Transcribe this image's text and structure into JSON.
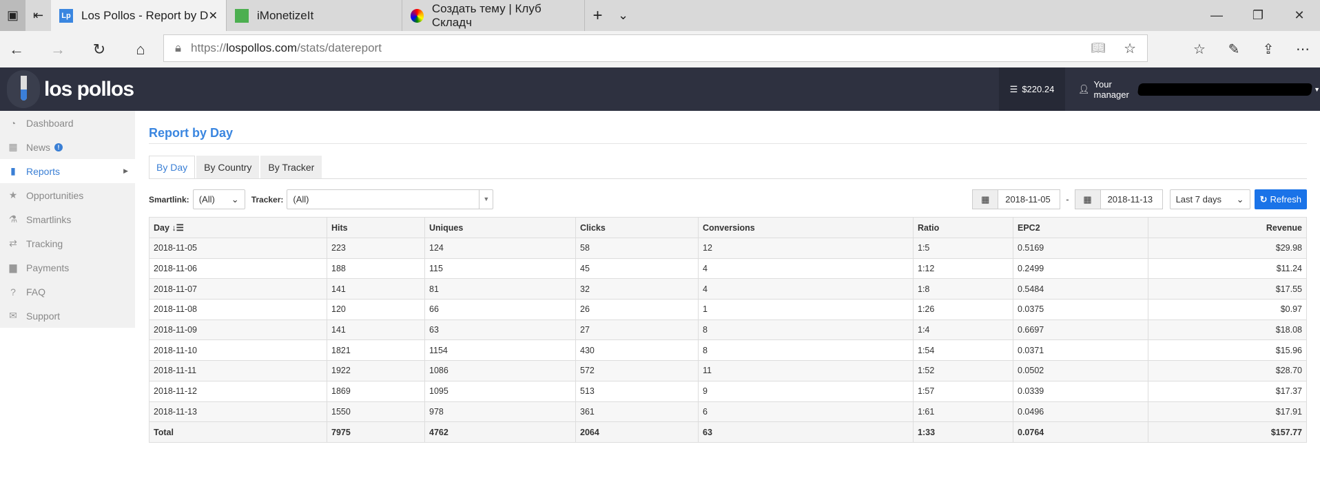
{
  "browser": {
    "tabs": [
      {
        "label": "Los Pollos - Report by D",
        "favicon": "Lp",
        "active": true
      },
      {
        "label": "iMonetizeIt",
        "active": false
      },
      {
        "label": "Создать тему | Клуб Складч",
        "active": false
      }
    ],
    "url_prefix": "https://",
    "url_domain": "lospollos.com",
    "url_path": "/stats/datereport"
  },
  "header": {
    "logo": "los pollos",
    "balance": "$220.24",
    "manager": "Your manager"
  },
  "sidebar": {
    "items": [
      {
        "label": "Dashboard",
        "icon": "dashboard-icon"
      },
      {
        "label": "News",
        "icon": "calendar-icon",
        "badge": "!"
      },
      {
        "label": "Reports",
        "icon": "bar-chart-icon",
        "active": true
      },
      {
        "label": "Opportunities",
        "icon": "star-icon"
      },
      {
        "label": "Smartlinks",
        "icon": "flask-icon"
      },
      {
        "label": "Tracking",
        "icon": "exchange-icon"
      },
      {
        "label": "Payments",
        "icon": "briefcase-icon"
      },
      {
        "label": "FAQ",
        "icon": "question-icon"
      },
      {
        "label": "Support",
        "icon": "envelope-icon"
      }
    ]
  },
  "page": {
    "title": "Report by Day",
    "tabs": [
      "By Day",
      "By Country",
      "By Tracker"
    ]
  },
  "filters": {
    "smartlink_label": "Smartlink:",
    "smartlink_value": "(All)",
    "tracker_label": "Tracker:",
    "tracker_value": "(All)",
    "date_from": "2018-11-05",
    "date_sep": "-",
    "date_to": "2018-11-13",
    "range": "Last 7 days",
    "refresh": "Refresh"
  },
  "table": {
    "headers": [
      "Day",
      "Hits",
      "Uniques",
      "Clicks",
      "Conversions",
      "Ratio",
      "EPC2",
      "Revenue"
    ],
    "rows": [
      [
        "2018-11-05",
        "223",
        "124",
        "58",
        "12",
        "1:5",
        "0.5169",
        "$29.98"
      ],
      [
        "2018-11-06",
        "188",
        "115",
        "45",
        "4",
        "1:12",
        "0.2499",
        "$11.24"
      ],
      [
        "2018-11-07",
        "141",
        "81",
        "32",
        "4",
        "1:8",
        "0.5484",
        "$17.55"
      ],
      [
        "2018-11-08",
        "120",
        "66",
        "26",
        "1",
        "1:26",
        "0.0375",
        "$0.97"
      ],
      [
        "2018-11-09",
        "141",
        "63",
        "27",
        "8",
        "1:4",
        "0.6697",
        "$18.08"
      ],
      [
        "2018-11-10",
        "1821",
        "1154",
        "430",
        "8",
        "1:54",
        "0.0371",
        "$15.96"
      ],
      [
        "2018-11-11",
        "1922",
        "1086",
        "572",
        "11",
        "1:52",
        "0.0502",
        "$28.70"
      ],
      [
        "2018-11-12",
        "1869",
        "1095",
        "513",
        "9",
        "1:57",
        "0.0339",
        "$17.37"
      ],
      [
        "2018-11-13",
        "1550",
        "978",
        "361",
        "6",
        "1:61",
        "0.0496",
        "$17.91"
      ]
    ],
    "total": [
      "Total",
      "7975",
      "4762",
      "2064",
      "63",
      "1:33",
      "0.0764",
      "$157.77"
    ]
  }
}
